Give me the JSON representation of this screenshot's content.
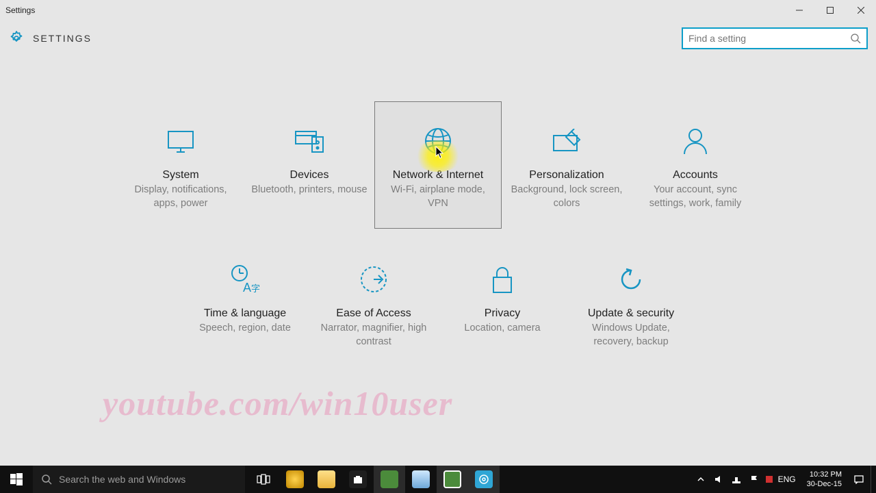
{
  "window": {
    "title": "Settings"
  },
  "header": {
    "app_title": "SETTINGS"
  },
  "search": {
    "placeholder": "Find a setting"
  },
  "accent": "#1795c3",
  "tiles": {
    "row1": [
      {
        "label": "System",
        "desc": "Display, notifications, apps, power"
      },
      {
        "label": "Devices",
        "desc": "Bluetooth, printers, mouse"
      },
      {
        "label": "Network & Internet",
        "desc": "Wi-Fi, airplane mode, VPN",
        "hovered": true
      },
      {
        "label": "Personalization",
        "desc": "Background, lock screen, colors"
      },
      {
        "label": "Accounts",
        "desc": "Your account, sync settings, work, family"
      }
    ],
    "row2": [
      {
        "label": "Time & language",
        "desc": "Speech, region, date"
      },
      {
        "label": "Ease of Access",
        "desc": "Narrator, magnifier, high contrast"
      },
      {
        "label": "Privacy",
        "desc": "Location, camera"
      },
      {
        "label": "Update & security",
        "desc": "Windows Update, recovery, backup"
      }
    ]
  },
  "watermark": "youtube.com/win10user",
  "taskbar": {
    "search_placeholder": "Search the web and Windows",
    "lang": "ENG",
    "time": "10:32 PM",
    "date": "30-Dec-15"
  }
}
